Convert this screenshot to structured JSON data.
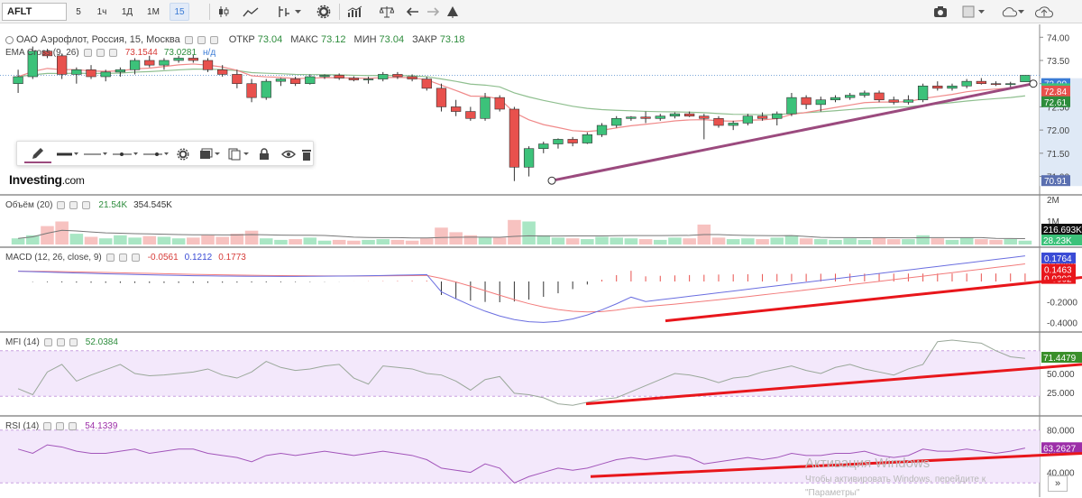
{
  "toolbar": {
    "symbol": "AFLT",
    "intervals": [
      "5",
      "1ч",
      "1Д",
      "1М",
      "15"
    ],
    "selected_interval": "15",
    "icons": [
      "candles-icon",
      "line-chart-icon",
      "indicators-icon",
      "settings-icon",
      "bar-compare-icon",
      "balance-icon",
      "undo-icon",
      "redo-icon",
      "alert-icon",
      "camera-icon",
      "color-square-icon",
      "cloud-icon",
      "cloud-upload-icon"
    ]
  },
  "main": {
    "title": "ОАО Аэрофлот, Россия, 15, Москва",
    "ohlc": [
      {
        "label": "ОТКР",
        "value": "73.04"
      },
      {
        "label": "МАКС",
        "value": "73.12"
      },
      {
        "label": "МИН",
        "value": "73.04"
      },
      {
        "label": "ЗАКР",
        "value": "73.18"
      }
    ],
    "ema_title": "EMA Cross (9, 26)",
    "ema_v1": "73.1544",
    "ema_v2": "73.0281",
    "ema_v3": "н/д"
  },
  "volume": {
    "title": "Объём (20)",
    "v1": "21.54K",
    "v2": "354.545K"
  },
  "macd": {
    "title": "MACD (12, 26, close, 9)",
    "v1": "-0.0561",
    "v2": "0.1212",
    "v3": "0.1773"
  },
  "mfi": {
    "title": "MFI (14)",
    "v1": "52.0384"
  },
  "rsi": {
    "title": "RSI (14)",
    "v1": "54.1339"
  },
  "logo": {
    "brand": "Investing",
    "suffix": ".com"
  },
  "watermark": {
    "line1": "Активация Windows",
    "line2": "Чтобы активировать Windows, перейдите к",
    "line3": "\"Параметры\""
  },
  "scroll_button": "»",
  "colors": {
    "up": "#3cc27a",
    "down": "#e8514d",
    "ema_fast": "#f08a8a",
    "ema_slow": "#8fbf8f",
    "trend": "#9b4a7e",
    "red_line": "#e8161b",
    "macd": "#6a6ee0",
    "signal": "#f27b7b",
    "mfi_line": "#9aa89a",
    "rsi_line": "#a255ba",
    "band": "#f3e8fb"
  },
  "chart_data": [
    {
      "type": "candlestick",
      "title": "ОАО Аэрофлот, Россия, 15, Москва",
      "ylim": [
        70.7,
        74.2
      ],
      "y_ticks": [
        "74.00",
        "73.50",
        "73.00",
        "72.50",
        "72.00",
        "71.50",
        "71.00"
      ],
      "last_labels": [
        "73.00",
        "72.89",
        "72.84",
        "72.61",
        "70.91"
      ],
      "candles": [
        [
          73.0,
          73.3,
          72.8,
          73.15
        ],
        [
          73.15,
          73.8,
          73.1,
          73.7
        ],
        [
          73.7,
          73.75,
          73.55,
          73.6
        ],
        [
          73.6,
          73.65,
          73.1,
          73.2
        ],
        [
          73.2,
          73.35,
          73.0,
          73.3
        ],
        [
          73.3,
          73.4,
          73.1,
          73.15
        ],
        [
          73.15,
          73.3,
          73.05,
          73.25
        ],
        [
          73.25,
          73.35,
          73.15,
          73.3
        ],
        [
          73.3,
          73.55,
          73.2,
          73.5
        ],
        [
          73.5,
          73.6,
          73.35,
          73.4
        ],
        [
          73.4,
          73.55,
          73.3,
          73.5
        ],
        [
          73.5,
          73.6,
          73.45,
          73.55
        ],
        [
          73.55,
          73.62,
          73.45,
          73.5
        ],
        [
          73.5,
          73.55,
          73.25,
          73.3
        ],
        [
          73.3,
          73.4,
          73.15,
          73.2
        ],
        [
          73.2,
          73.3,
          72.9,
          73.0
        ],
        [
          73.0,
          73.1,
          72.6,
          72.7
        ],
        [
          72.7,
          73.1,
          72.65,
          73.05
        ],
        [
          73.05,
          73.12,
          72.95,
          73.1
        ],
        [
          73.1,
          73.15,
          72.95,
          73.0
        ],
        [
          73.0,
          73.2,
          72.98,
          73.15
        ],
        [
          73.15,
          73.2,
          73.1,
          73.18
        ],
        [
          73.18,
          73.22,
          73.08,
          73.12
        ],
        [
          73.12,
          73.16,
          73.05,
          73.08
        ],
        [
          73.08,
          73.15,
          73.0,
          73.1
        ],
        [
          73.1,
          73.25,
          73.05,
          73.2
        ],
        [
          73.2,
          73.25,
          73.1,
          73.15
        ],
        [
          73.15,
          73.2,
          73.05,
          73.1
        ],
        [
          73.1,
          73.15,
          72.85,
          72.9
        ],
        [
          72.9,
          73.0,
          72.4,
          72.5
        ],
        [
          72.5,
          72.65,
          72.3,
          72.4
        ],
        [
          72.4,
          72.5,
          72.2,
          72.25
        ],
        [
          72.25,
          72.8,
          72.2,
          72.7
        ],
        [
          72.7,
          72.75,
          72.4,
          72.45
        ],
        [
          72.45,
          72.5,
          70.9,
          71.2
        ],
        [
          71.2,
          71.65,
          71.0,
          71.6
        ],
        [
          71.6,
          71.75,
          71.5,
          71.7
        ],
        [
          71.7,
          71.82,
          71.6,
          71.8
        ],
        [
          71.8,
          71.85,
          71.65,
          71.72
        ],
        [
          71.72,
          71.95,
          71.7,
          71.9
        ],
        [
          71.9,
          72.15,
          71.85,
          72.1
        ],
        [
          72.1,
          72.3,
          72.05,
          72.25
        ],
        [
          72.25,
          72.3,
          72.2,
          72.28
        ],
        [
          72.28,
          72.4,
          72.15,
          72.25
        ],
        [
          72.25,
          72.35,
          72.2,
          72.3
        ],
        [
          72.3,
          72.38,
          72.25,
          72.35
        ],
        [
          72.35,
          72.4,
          72.28,
          72.3
        ],
        [
          72.3,
          72.35,
          71.8,
          72.25
        ],
        [
          72.25,
          72.3,
          72.05,
          72.1
        ],
        [
          72.1,
          72.2,
          72.0,
          72.15
        ],
        [
          72.15,
          72.35,
          72.1,
          72.3
        ],
        [
          72.3,
          72.38,
          72.2,
          72.25
        ],
        [
          72.25,
          72.4,
          72.1,
          72.35
        ],
        [
          72.35,
          72.8,
          72.3,
          72.7
        ],
        [
          72.7,
          72.75,
          72.45,
          72.55
        ],
        [
          72.55,
          72.72,
          72.4,
          72.65
        ],
        [
          72.65,
          72.75,
          72.6,
          72.7
        ],
        [
          72.7,
          72.8,
          72.65,
          72.75
        ],
        [
          72.75,
          72.85,
          72.7,
          72.8
        ],
        [
          72.8,
          72.85,
          72.6,
          72.65
        ],
        [
          72.65,
          72.72,
          72.55,
          72.6
        ],
        [
          72.6,
          72.75,
          72.55,
          72.65
        ],
        [
          72.65,
          73.0,
          72.6,
          72.95
        ],
        [
          72.95,
          73.05,
          72.85,
          72.9
        ],
        [
          72.9,
          73.0,
          72.85,
          72.95
        ],
        [
          72.95,
          73.1,
          72.9,
          73.05
        ],
        [
          73.05,
          73.12,
          72.98,
          73.0
        ],
        [
          73.0,
          73.05,
          72.95,
          72.98
        ],
        [
          72.98,
          73.04,
          72.9,
          73.0
        ],
        [
          73.04,
          73.12,
          73.04,
          73.18
        ]
      ]
    },
    {
      "type": "bar",
      "title": "Объём (20)",
      "y_ticks": [
        "2M",
        "1M"
      ],
      "last_labels": [
        "216.693K",
        "28.23K"
      ]
    },
    {
      "type": "line",
      "title": "MACD (12, 26, close, 9)",
      "y_ticks": [
        "0.2000",
        "-0.2000",
        "-0.4000"
      ],
      "last_labels": [
        "0.1764",
        "0.1463",
        "0.0302"
      ]
    },
    {
      "type": "line",
      "title": "MFI (14)",
      "y_ticks": [
        "75.000",
        "50.000",
        "25.000"
      ],
      "last_labels": [
        "71.4479"
      ],
      "ylim": [
        0,
        100
      ]
    },
    {
      "type": "line",
      "title": "RSI (14)",
      "y_ticks": [
        "80.000",
        "60.000",
        "40.000"
      ],
      "last_labels": [
        "63.2627"
      ],
      "ylim": [
        20,
        90
      ]
    }
  ]
}
